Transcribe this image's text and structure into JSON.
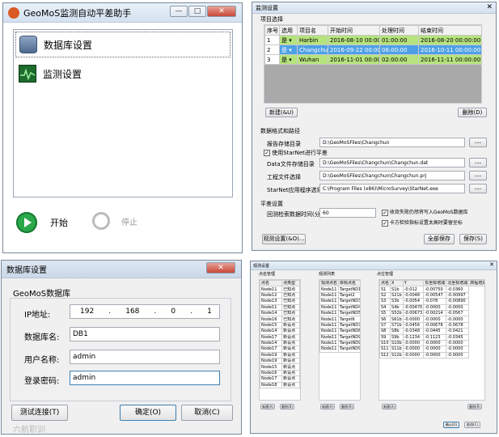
{
  "main_app": {
    "title": "GeoMoS监测自动平差助手",
    "title_buttons": [
      "—",
      "□",
      "✕"
    ],
    "menu": [
      {
        "label": "数据库设置",
        "icon": "database-icon"
      },
      {
        "label": "监测设置",
        "icon": "monitor-chart-icon"
      }
    ],
    "start_label": "开始",
    "stop_label": "停止",
    "colors": {
      "play": "#2aa84a",
      "selected": "#3399ff"
    }
  },
  "monitor": {
    "title": "监测设置",
    "project_group": "项目选择",
    "columns": [
      "序号",
      "选用",
      "项目名",
      "开始时间",
      "处理时间",
      "结束时间"
    ],
    "rows": [
      {
        "no": "1",
        "use": "是",
        "name": "Harbin",
        "start": "2016-08-10 00:00:00",
        "proc": "01:00:00",
        "end": "2016-08-20 00:00:00",
        "color": "#b6e37e"
      },
      {
        "no": "2",
        "use": "是",
        "name": "Changchun",
        "start": "2016-09-22 00:00:00",
        "proc": "06:00:00",
        "end": "2016-10-11 00:00:00",
        "color": "#4ea0e6"
      },
      {
        "no": "3",
        "use": "是",
        "name": "Wuhan",
        "start": "2016-11-01 00:00:00",
        "proc": "02:00:00",
        "end": "2016-11-11 00:00:00",
        "color": "#b6e37e"
      }
    ],
    "new_label": "新建(&U)",
    "delete_label": "删除(D)",
    "format_group": "数据格式和路径",
    "report_dir_label": "报告存储目录",
    "report_dir": "D:\\GeoMoSFiles\\Changchun",
    "use_starnet_label": "使用StarNet进行平差",
    "data_dir_label": "Data文件存储目录",
    "data_dir": "D:\\GeoMoSFiles\\Changchun\\Changchun.dat",
    "project_file_label": "工程文件选择",
    "project_file": "D:\\GeoMoSFiles\\Changchun\\Changchun.prj",
    "starnet_path_label": "StarNet应用程序选择",
    "starnet_path": "C:\\Program Files (x86)\\MicroSurvey\\StarNet.exe",
    "browse_label": "...",
    "adjust_group": "平差设置",
    "interval_label": "回测检索数据时间(分钟)",
    "interval": "60",
    "opt1": "收敛失败仍然将写入GeoMoS数据库",
    "opt2": "卡方检验指标设置太高时要留坐标",
    "test_label": "观测设置(&O)...",
    "save_all_label": "全部保存",
    "save_label": "保存(S)"
  },
  "db": {
    "title": "数据库设置",
    "group": "GeoMoS数据库",
    "ip_label": "IP地址:",
    "ip": [
      "192",
      "168",
      "0",
      "1"
    ],
    "dbname_label": "数据库名:",
    "dbname": "DB1",
    "user_label": "用户名称:",
    "user": "admin",
    "pwd_label": "登录密码:",
    "pwd": "admin",
    "test_label": "测试连接(T)",
    "ok_label": "确定(O)",
    "cancel_label": "取消(C)",
    "watermark": "六航职训"
  },
  "points": {
    "title": "观测设置",
    "g1": "点名管理",
    "g2": "观测列表",
    "g3": "点位管理",
    "c1": [
      "点名",
      "点类型"
    ],
    "c2": [
      "观测点名",
      "目标点名"
    ],
    "c3": [
      "点名",
      "X",
      "Y",
      "东坐标增减",
      "北坐标增减",
      "高程增减H"
    ],
    "l1": [
      [
        "Node11",
        "已知点"
      ],
      [
        "Node12",
        "已知点"
      ],
      [
        "Node13",
        "已知点"
      ],
      [
        "Node11",
        "已知点"
      ],
      [
        "Node14",
        "已知点"
      ],
      [
        "Node16",
        "已知点"
      ],
      [
        "Node15",
        "新设点"
      ],
      [
        "Node14",
        "新设点"
      ],
      [
        "Node17",
        "新设点"
      ],
      [
        "Node14",
        "新设点"
      ],
      [
        "Node17",
        "新设点"
      ],
      [
        "Node19",
        "新设点"
      ],
      [
        "Node19",
        "新设点"
      ],
      [
        "Node15",
        "新设点"
      ],
      [
        "Node16",
        "新设点"
      ],
      [
        "Node17",
        "新设点"
      ],
      [
        "Node18",
        "新设点"
      ]
    ],
    "l2": [
      [
        "Node11",
        "TargetND1"
      ],
      [
        "Node11",
        "Target2"
      ],
      [
        "Node11",
        "TargetND3"
      ],
      [
        "Node11",
        "TargetND4"
      ],
      [
        "Node11",
        "TargetND5"
      ],
      [
        "Node11",
        "Target6"
      ],
      [
        "Node11",
        "TargetND7"
      ],
      [
        "Node11",
        "TargetND8"
      ],
      [
        "Node11",
        "TargetND9"
      ],
      [
        "Node11",
        "TargetND9"
      ],
      [
        "Node11",
        "TargetND9"
      ]
    ],
    "l3": [
      [
        "S1",
        "S1b",
        "-0.012",
        "-0.00750",
        "-0.0360"
      ],
      [
        "S2",
        "S21b",
        "-0.0048",
        "-0.00547",
        "-0.00997"
      ],
      [
        "S3",
        "S3b",
        "-0.0054",
        "-0.078",
        "-0.00890"
      ],
      [
        "S4",
        "S4b",
        "-0.00470",
        "-0.0000",
        "-0.0000"
      ],
      [
        "S5",
        "S52b",
        "-0.00673",
        "-0.00214",
        "-0.0567"
      ],
      [
        "S6",
        "S61b",
        "-0.0000",
        "-0.0000",
        "-0.0000"
      ],
      [
        "S7",
        "S71b",
        "-0.0456",
        "-0.00678",
        "-0.0678"
      ],
      [
        "S8",
        "S8b",
        "-0.0348",
        "-0.0445",
        "-0.0421"
      ],
      [
        "S9",
        "S9b",
        "-0.1234",
        "-0.1123",
        "-0.0345"
      ],
      [
        "S10",
        "S10b",
        "-0.0000",
        "-0.0000",
        "-0.0000"
      ],
      [
        "S11",
        "S11b",
        "-0.0000",
        "-0.0000",
        "-0.0000"
      ],
      [
        "S12",
        "S12b",
        "-0.0000",
        "-0.0000",
        "-0.0000"
      ]
    ],
    "add_label": "新建(A)",
    "del_label": "删除(R)",
    "ok_label": "确认(O)",
    "cancel_label": "取消(C)"
  }
}
